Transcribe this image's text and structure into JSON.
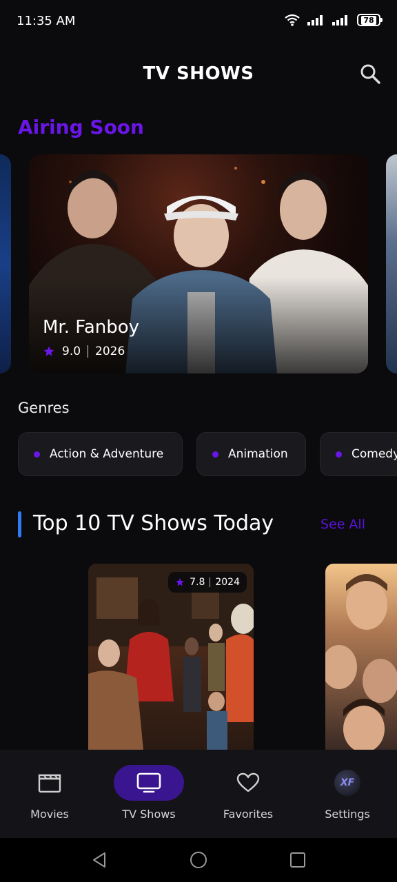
{
  "status_bar": {
    "time": "11:35 AM",
    "battery": "78"
  },
  "header": {
    "title": "TV SHOWS"
  },
  "airing_soon": {
    "title": "Airing Soon",
    "featured": {
      "title": "Mr. Fanboy",
      "rating": "9.0",
      "year": "2026"
    }
  },
  "genres": {
    "label": "Genres",
    "items": [
      {
        "label": "Action & Adventure"
      },
      {
        "label": "Animation"
      },
      {
        "label": "Comedy"
      }
    ]
  },
  "top10": {
    "title": "Top 10 TV Shows Today",
    "see_all": "See All",
    "items": [
      {
        "rating": "7.8",
        "year": "2024"
      }
    ]
  },
  "bottom_nav": {
    "items": [
      {
        "label": "Movies",
        "icon": "clapperboard-icon",
        "active": false
      },
      {
        "label": "TV Shows",
        "icon": "tv-icon",
        "active": true
      },
      {
        "label": "Favorites",
        "icon": "heart-icon",
        "active": false
      },
      {
        "label": "Settings",
        "icon": "xf-logo-icon",
        "active": false
      }
    ]
  },
  "colors": {
    "accent": "#6a16e8",
    "active_nav": "#3a1590",
    "blue_bar": "#2e7cf6",
    "background": "#0b0a0d"
  }
}
